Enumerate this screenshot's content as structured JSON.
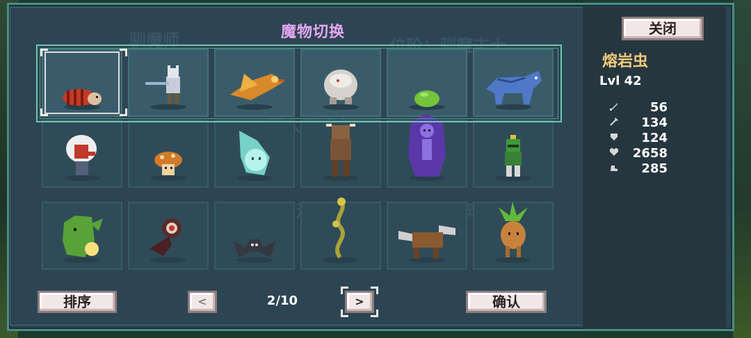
{
  "dialog": {
    "title": "魔物切换",
    "close_label": "关闭",
    "sort_label": "排序",
    "confirm_label": "确认",
    "prev_label": "<",
    "next_label": ">",
    "page": "2/10"
  },
  "background_text": [
    "驯魔师",
    "位阶：驯魔志士",
    "熔岩虫",
    "猫人狂战士",
    "野人",
    "波球",
    "幽灵狼"
  ],
  "selected": {
    "name": "熔岩虫",
    "level": "Lvl 42",
    "stats": [
      {
        "icon": "sword-icon",
        "value": "56"
      },
      {
        "icon": "magic-wand-icon",
        "value": "134"
      },
      {
        "icon": "shield-icon",
        "value": "124"
      },
      {
        "icon": "heart-icon",
        "value": "2658"
      },
      {
        "icon": "boot-icon",
        "value": "285"
      }
    ]
  },
  "monsters": [
    {
      "id": "lava-worm",
      "row": 1,
      "col": 1,
      "active": true
    },
    {
      "id": "cat-knight",
      "row": 1,
      "col": 2
    },
    {
      "id": "fire-bird",
      "row": 1,
      "col": 3
    },
    {
      "id": "rock-golem",
      "row": 1,
      "col": 4
    },
    {
      "id": "green-slime",
      "row": 1,
      "col": 5
    },
    {
      "id": "ghost-wolf",
      "row": 1,
      "col": 6
    },
    {
      "id": "red-face-shaman",
      "row": 2,
      "col": 1
    },
    {
      "id": "mushroom",
      "row": 2,
      "col": 2
    },
    {
      "id": "ice-spirit",
      "row": 2,
      "col": 3
    },
    {
      "id": "minotaur",
      "row": 2,
      "col": 4
    },
    {
      "id": "shadow-skeleton",
      "row": 2,
      "col": 5
    },
    {
      "id": "green-knight",
      "row": 2,
      "col": 6
    },
    {
      "id": "goblin-lantern",
      "row": 3,
      "col": 1
    },
    {
      "id": "eye-worm",
      "row": 3,
      "col": 2
    },
    {
      "id": "bat",
      "row": 3,
      "col": 3
    },
    {
      "id": "snake-vine",
      "row": 3,
      "col": 4
    },
    {
      "id": "drill-beast",
      "row": 3,
      "col": 5
    },
    {
      "id": "mandrake",
      "row": 3,
      "col": 6
    }
  ]
}
